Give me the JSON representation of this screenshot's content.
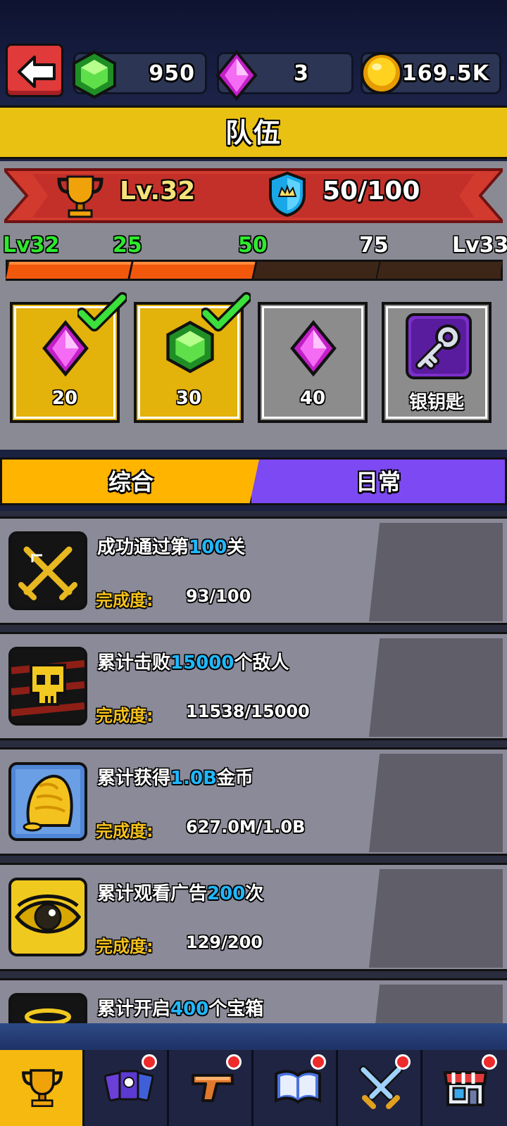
{
  "header": {
    "back_label": "",
    "emerald_count": "950",
    "diamond_count": "3",
    "coin_count": "169.5K"
  },
  "title": "队伍",
  "level_panel": {
    "level_text": "Lv.32",
    "points_text": "50/100",
    "points_current": 50,
    "points_max": 100,
    "milestones": [
      "Lv32",
      "25",
      "50",
      "75",
      "Lv33"
    ],
    "rewards": [
      {
        "amount": "20",
        "icon": "pink-gem-icon",
        "claimed": true
      },
      {
        "amount": "30",
        "icon": "green-gem-icon",
        "claimed": true
      },
      {
        "amount": "40",
        "icon": "pink-gem-icon",
        "claimed": false
      },
      {
        "amount": "银钥匙",
        "icon": "silver-key-icon",
        "claimed": false
      }
    ]
  },
  "tabs": {
    "general": "综合",
    "daily": "日常"
  },
  "quests": [
    {
      "pre": "成功通过第",
      "hl": "100",
      "post": "关",
      "label": "完成度:",
      "progress": "93/100",
      "icon": "crossed-swords-icon"
    },
    {
      "pre": "累计击败",
      "hl": "15000",
      "post": "个敌人",
      "label": "完成度:",
      "progress": "11538/15000",
      "icon": "skull-icon"
    },
    {
      "pre": "累计获得",
      "hl": "1.0B",
      "post": "金币",
      "label": "完成度:",
      "progress": "627.0M/1.0B",
      "icon": "gold-pile-icon"
    },
    {
      "pre": "累计观看广告",
      "hl": "200",
      "post": "次",
      "label": "完成度:",
      "progress": "129/200",
      "icon": "eye-icon"
    },
    {
      "pre": "累计开启",
      "hl": "400",
      "post": "个宝箱",
      "label": "",
      "progress": "",
      "icon": "chest-halo-icon"
    }
  ],
  "nav": [
    "trophy-icon",
    "cards-icon",
    "pistol-icon",
    "book-icon",
    "swords-icon",
    "shop-icon"
  ]
}
